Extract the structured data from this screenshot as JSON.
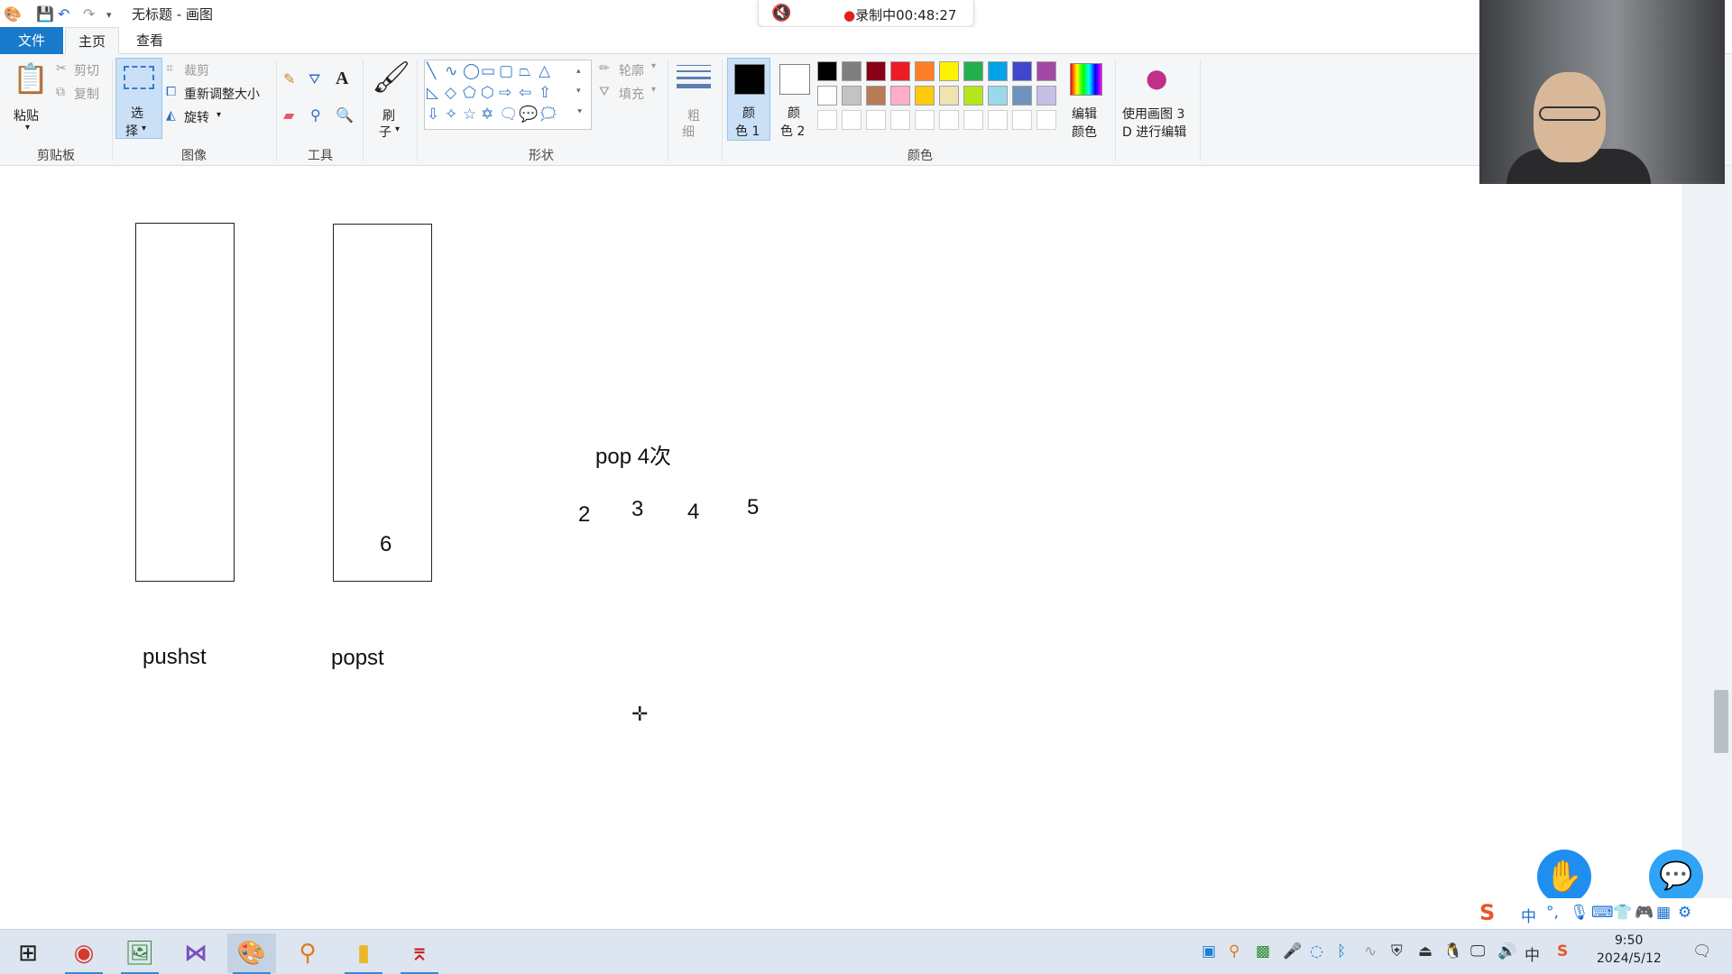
{
  "window": {
    "title": "无标题 - 画图",
    "quick_access": [
      "save-icon",
      "undo-icon",
      "redo-icon",
      "customize-icon"
    ]
  },
  "recording": {
    "dot": "●",
    "label": "录制中00:48:27"
  },
  "tabs": [
    {
      "label": "文件"
    },
    {
      "label": "主页"
    },
    {
      "label": "查看"
    }
  ],
  "ribbon": {
    "clipboard": {
      "group": "剪贴板",
      "paste": "粘贴",
      "cut": "剪切",
      "copy": "复制"
    },
    "image": {
      "group": "图像",
      "select_top": "选",
      "select_bottom": "择",
      "crop": "裁剪",
      "resize": "重新调整大小",
      "rotate": "旋转"
    },
    "tools": {
      "group": "工具"
    },
    "brushes": {
      "top": "刷",
      "bottom": "子"
    },
    "shapes": {
      "group": "形状",
      "outline": "轮廓",
      "fill": "填充"
    },
    "size": {
      "top": "粗",
      "bottom": "细"
    },
    "colors": {
      "group": "颜色",
      "color1_top": "颜",
      "color1_bottom": "色 1",
      "color2_top": "颜",
      "color2_bottom": "色 2",
      "edit_top": "编辑",
      "edit_bottom": "颜色",
      "color1_value": "#000000",
      "color2_value": "#ffffff",
      "palette_row1": [
        "#000000",
        "#7f7f7f",
        "#880015",
        "#ed1c24",
        "#ff7f27",
        "#fff200",
        "#22b14c",
        "#00a2e8",
        "#3f48cc",
        "#a349a4"
      ],
      "palette_row2": [
        "#ffffff",
        "#c3c3c3",
        "#b97a57",
        "#ffaec9",
        "#ffc90e",
        "#efe4b0",
        "#b5e61d",
        "#99d9ea",
        "#7092be",
        "#c8bfe7"
      ]
    },
    "paint3d": {
      "line1": "使用画图 3",
      "line2": "D 进行编辑"
    }
  },
  "canvas": {
    "stack1_value": "6",
    "label_pushst": "pushst",
    "label_popst": "popst",
    "note": "pop 4次",
    "n2": "2",
    "n3": "3",
    "n4": "4",
    "n5": "5"
  },
  "taskbar": {
    "apps": [
      "windows-start",
      "chrome",
      "paint-app",
      "visual-studio",
      "paint-active",
      "search-tool",
      "file-explorer",
      "pdf-reader"
    ],
    "clock_time": "9:50",
    "clock_date": "2024/5/12"
  },
  "ime": {
    "lang": "中"
  }
}
